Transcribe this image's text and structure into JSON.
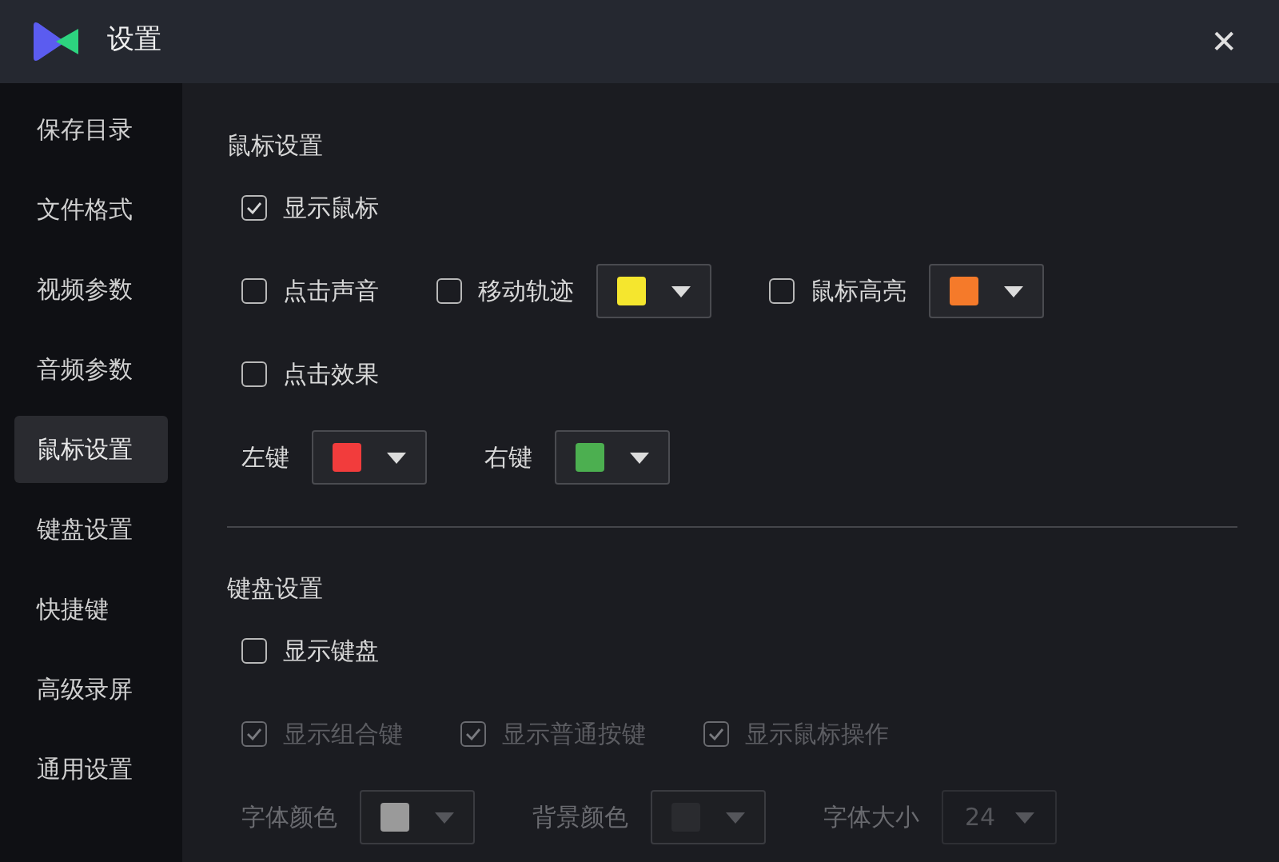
{
  "window": {
    "title": "设置",
    "close": "✕"
  },
  "sidebar": {
    "items": [
      {
        "label": "保存目录",
        "selected": false
      },
      {
        "label": "文件格式",
        "selected": false
      },
      {
        "label": "视频参数",
        "selected": false
      },
      {
        "label": "音频参数",
        "selected": false
      },
      {
        "label": "鼠标设置",
        "selected": true
      },
      {
        "label": "键盘设置",
        "selected": false
      },
      {
        "label": "快捷键",
        "selected": false
      },
      {
        "label": "高级录屏",
        "selected": false
      },
      {
        "label": "通用设置",
        "selected": false
      }
    ]
  },
  "sections": [
    {
      "title": "鼠标设置",
      "rows": [
        [
          [
            {
              "kind": "checkbox",
              "label": "显示鼠标",
              "checked": true,
              "disabled": false
            }
          ]
        ],
        [
          [
            {
              "kind": "checkbox",
              "label": "点击声音",
              "checked": false,
              "disabled": false
            }
          ],
          [
            {
              "kind": "checkbox",
              "label": "移动轨迹",
              "checked": false,
              "disabled": false
            },
            {
              "kind": "color",
              "color": "#f5e62e",
              "disabled": false
            }
          ],
          [
            {
              "kind": "checkbox",
              "label": "鼠标高亮",
              "checked": false,
              "disabled": false
            },
            {
              "kind": "color",
              "color": "#f57a2a",
              "disabled": false
            }
          ]
        ],
        [
          [
            {
              "kind": "checkbox",
              "label": "点击效果",
              "checked": false,
              "disabled": false
            }
          ]
        ],
        [
          [
            {
              "kind": "label",
              "text": "左键",
              "disabled": false
            },
            {
              "kind": "color",
              "color": "#f23c3c",
              "disabled": false
            }
          ],
          [
            {
              "kind": "label",
              "text": "右键",
              "disabled": false
            },
            {
              "kind": "color",
              "color": "#4caf50",
              "disabled": false
            }
          ]
        ]
      ]
    },
    {
      "title": "键盘设置",
      "rows": [
        [
          [
            {
              "kind": "checkbox",
              "label": "显示键盘",
              "checked": false,
              "disabled": false
            }
          ]
        ],
        [
          [
            {
              "kind": "checkbox",
              "label": "显示组合键",
              "checked": true,
              "disabled": true
            }
          ],
          [
            {
              "kind": "checkbox",
              "label": "显示普通按键",
              "checked": true,
              "disabled": true
            }
          ],
          [
            {
              "kind": "checkbox",
              "label": "显示鼠标操作",
              "checked": true,
              "disabled": true
            }
          ]
        ],
        [
          [
            {
              "kind": "label",
              "text": "字体颜色",
              "disabled": true
            },
            {
              "kind": "color",
              "color": "#9a9a9a",
              "disabled": true
            }
          ],
          [
            {
              "kind": "label",
              "text": "背景颜色",
              "disabled": true
            },
            {
              "kind": "color",
              "color": "#2a2b2f",
              "disabled": true
            }
          ],
          [
            {
              "kind": "label",
              "text": "字体大小",
              "disabled": true
            },
            {
              "kind": "select",
              "value": "24",
              "disabled": true
            }
          ]
        ]
      ]
    }
  ]
}
